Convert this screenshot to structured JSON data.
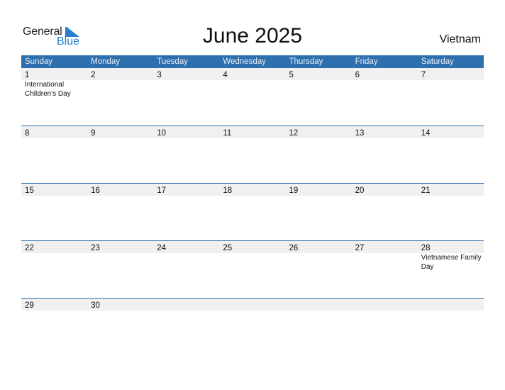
{
  "brand": {
    "general": "General",
    "blue": "Blue"
  },
  "title": "June 2025",
  "country": "Vietnam",
  "weekdays": [
    "Sunday",
    "Monday",
    "Tuesday",
    "Wednesday",
    "Thursday",
    "Friday",
    "Saturday"
  ],
  "weeks": [
    {
      "days": [
        "1",
        "2",
        "3",
        "4",
        "5",
        "6",
        "7"
      ],
      "holidays": [
        "International Children's Day",
        "",
        "",
        "",
        "",
        "",
        ""
      ]
    },
    {
      "days": [
        "8",
        "9",
        "10",
        "11",
        "12",
        "13",
        "14"
      ],
      "holidays": [
        "",
        "",
        "",
        "",
        "",
        "",
        ""
      ]
    },
    {
      "days": [
        "15",
        "16",
        "17",
        "18",
        "19",
        "20",
        "21"
      ],
      "holidays": [
        "",
        "",
        "",
        "",
        "",
        "",
        ""
      ]
    },
    {
      "days": [
        "22",
        "23",
        "24",
        "25",
        "26",
        "27",
        "28"
      ],
      "holidays": [
        "",
        "",
        "",
        "",
        "",
        "",
        "Vietnamese Family Day"
      ]
    },
    {
      "days": [
        "29",
        "30",
        "",
        "",
        "",
        "",
        ""
      ],
      "holidays": [
        "",
        "",
        "",
        "",
        "",
        "",
        ""
      ]
    }
  ],
  "colors": {
    "header": "#2e6fae",
    "brand_blue": "#2a7fcf",
    "strip": "#f0f0f0"
  }
}
